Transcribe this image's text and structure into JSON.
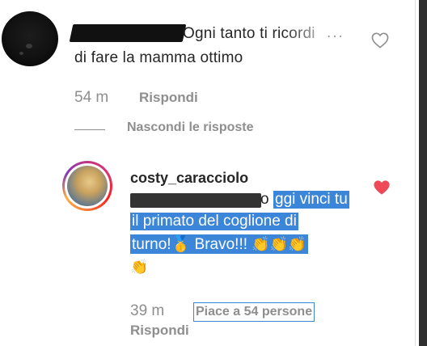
{
  "comment": {
    "text_line1": "Ogni tanto ti ricordi",
    "more_glyph": "...",
    "text_line2": "di fare la mamma ottimo",
    "time": "54 m",
    "reply_label": "Rispondi",
    "hide_replies_label": "Nascondi le risposte"
  },
  "reply": {
    "username": "costy_caracciolo",
    "text_lead": "o",
    "text_line1": "ggi vinci tu",
    "text_line2": "il primato del coglione di",
    "text_line3_prefix": "turno!",
    "text_line3_suffix": "Bravo!!!",
    "medal": "🥇",
    "claps_line3": "👏👏👏",
    "claps_line4": "👏",
    "time": "39 m",
    "likes_label": "Piace a 54 persone",
    "reply_label": "Rispondi",
    "liked": true
  },
  "colors": {
    "selection": "#3b86d9",
    "heart_liked": "#ed4956",
    "muted_text": "#8e8e8e"
  }
}
